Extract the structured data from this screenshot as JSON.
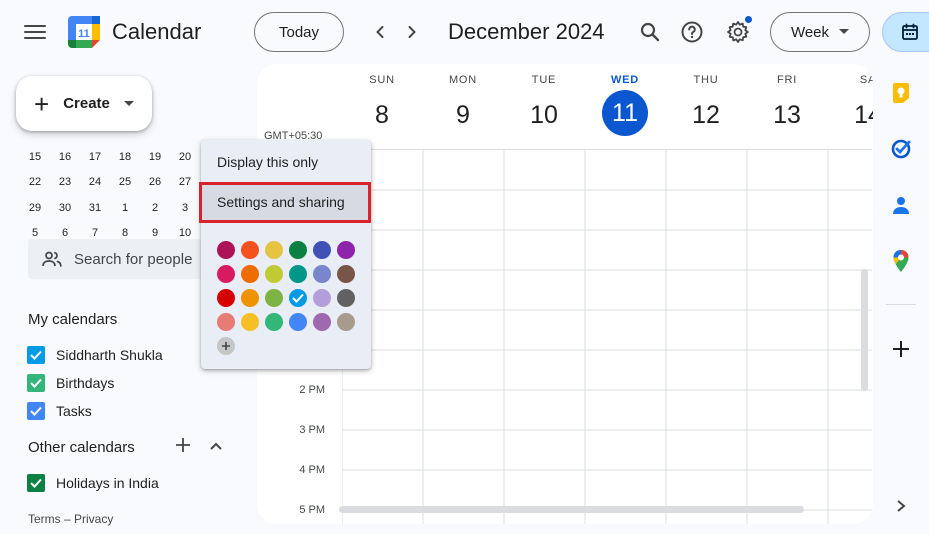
{
  "header": {
    "app_title": "Calendar",
    "logo_day": "11",
    "today_label": "Today",
    "month_title": "December 2024",
    "view_label": "Week"
  },
  "sidebar": {
    "create_label": "Create",
    "mini_calendar_rows": [
      [
        "15",
        "16",
        "17",
        "18",
        "19",
        "20"
      ],
      [
        "22",
        "23",
        "24",
        "25",
        "26",
        "27"
      ],
      [
        "29",
        "30",
        "31",
        "1",
        "2",
        "3"
      ],
      [
        "5",
        "6",
        "7",
        "8",
        "9",
        "10"
      ]
    ],
    "search_people_placeholder": "Search for people",
    "my_calendars_title": "My calendars",
    "my_calendars": [
      {
        "label": "Siddharth Shukla",
        "color": "#039be5"
      },
      {
        "label": "Birthdays",
        "color": "#33b679"
      },
      {
        "label": "Tasks",
        "color": "#4285f4"
      }
    ],
    "other_calendars_title": "Other calendars",
    "other_calendars": [
      {
        "label": "Holidays in India",
        "color": "#0b8043"
      }
    ],
    "footer": "Terms – Privacy"
  },
  "week": {
    "timezone": "GMT+05:30",
    "days": [
      {
        "name": "SUN",
        "num": "8"
      },
      {
        "name": "MON",
        "num": "9"
      },
      {
        "name": "TUE",
        "num": "10"
      },
      {
        "name": "WED",
        "num": "11",
        "active": true
      },
      {
        "name": "THU",
        "num": "12"
      },
      {
        "name": "FRI",
        "num": "13"
      },
      {
        "name": "SA",
        "num": "14"
      }
    ],
    "time_labels": [
      "2 PM",
      "3 PM",
      "4 PM",
      "5 PM"
    ]
  },
  "popup": {
    "item_display_only": "Display this only",
    "item_settings": "Settings and sharing",
    "swatch_rows": [
      [
        "#ad1457",
        "#f4511e",
        "#e4c441",
        "#0b8043",
        "#3f51b5",
        "#8e24aa"
      ],
      [
        "#d81b60",
        "#ef6c00",
        "#c0ca33",
        "#009688",
        "#7986cb",
        "#795548"
      ],
      [
        "#d50000",
        "#f09300",
        "#7cb342",
        "#039be5",
        "#b39ddb",
        "#616161"
      ],
      [
        "#e67c73",
        "#f6bf26",
        "#33b679",
        "#4285f4",
        "#9e69af",
        "#a79b8e"
      ]
    ],
    "selected_swatch": "#039be5"
  },
  "colors": {
    "accent": "#0b57d0",
    "highlight": "#d9232c"
  }
}
